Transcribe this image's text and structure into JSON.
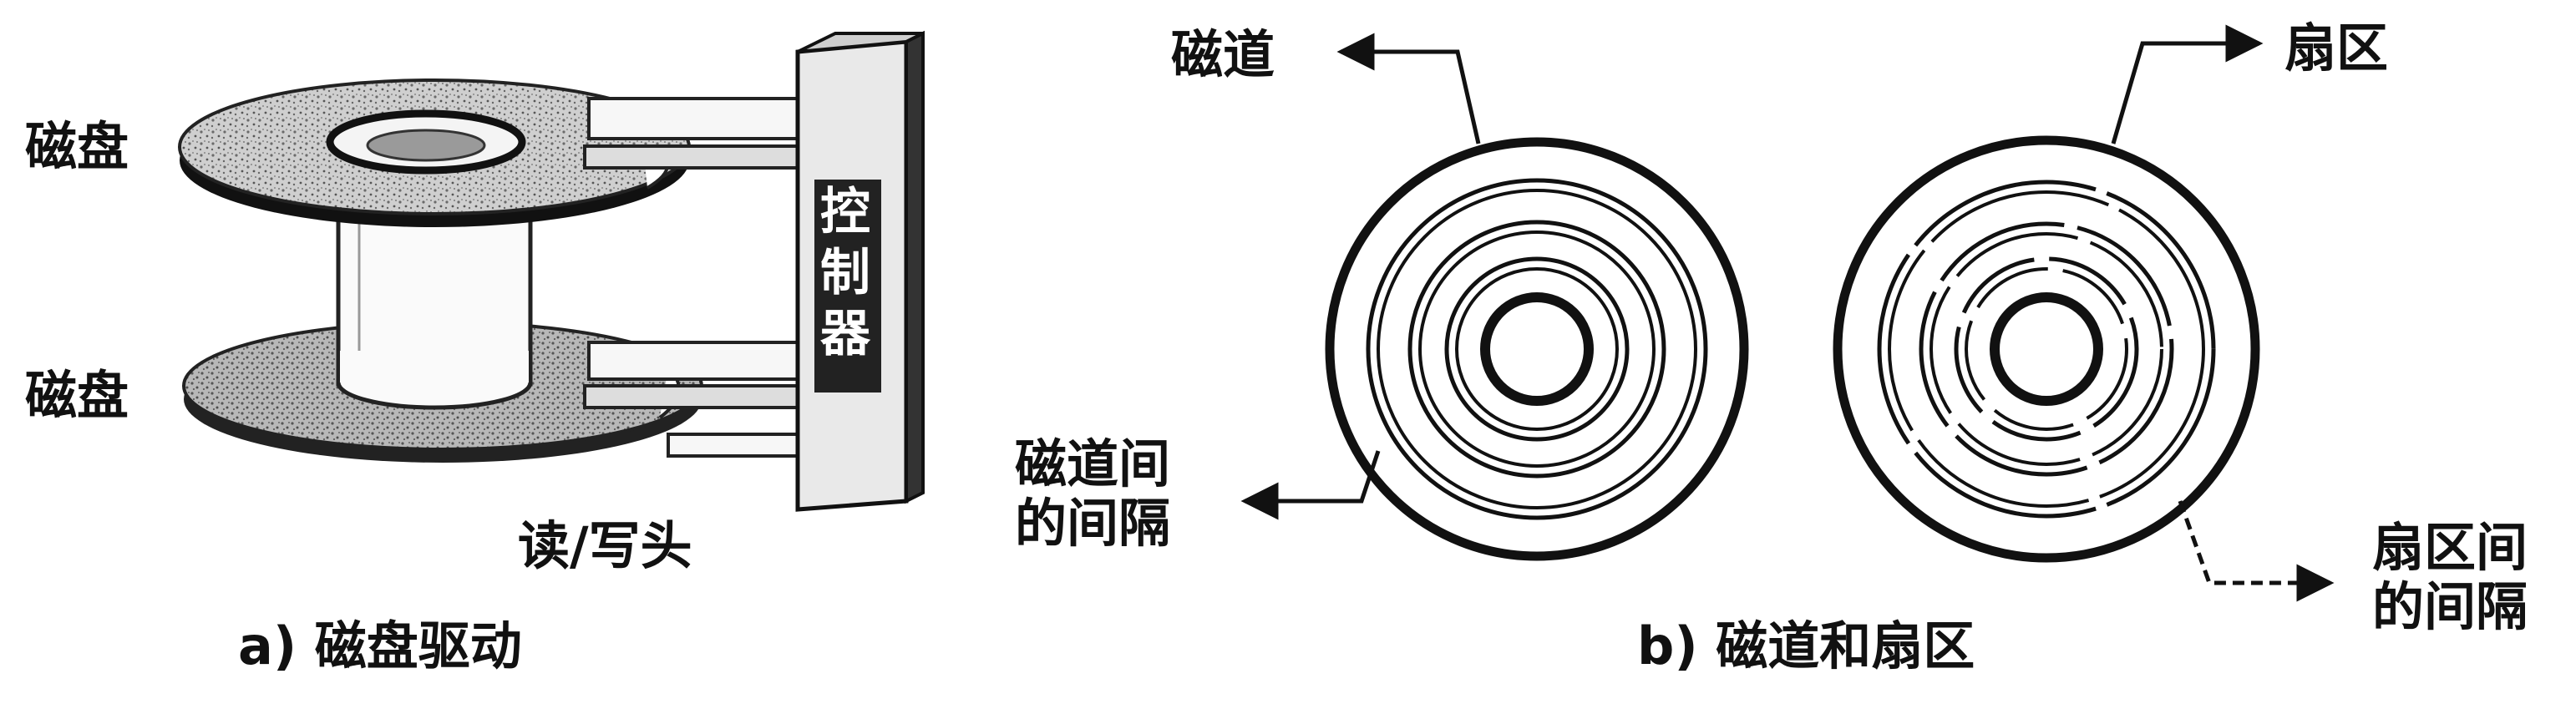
{
  "panel_a": {
    "disk_top_label": "磁盘",
    "disk_bottom_label": "磁盘",
    "controller_chars": [
      "控",
      "制",
      "器"
    ],
    "head_label": "读/写头",
    "caption": "a) 磁盘驱动"
  },
  "panel_b": {
    "track_label": "磁道",
    "sector_label": "扇区",
    "track_gap_lines": [
      "磁道间",
      "的间隔"
    ],
    "sector_gap_lines": [
      "扇区间",
      "的间隔"
    ],
    "caption": "b) 磁道和扇区"
  }
}
